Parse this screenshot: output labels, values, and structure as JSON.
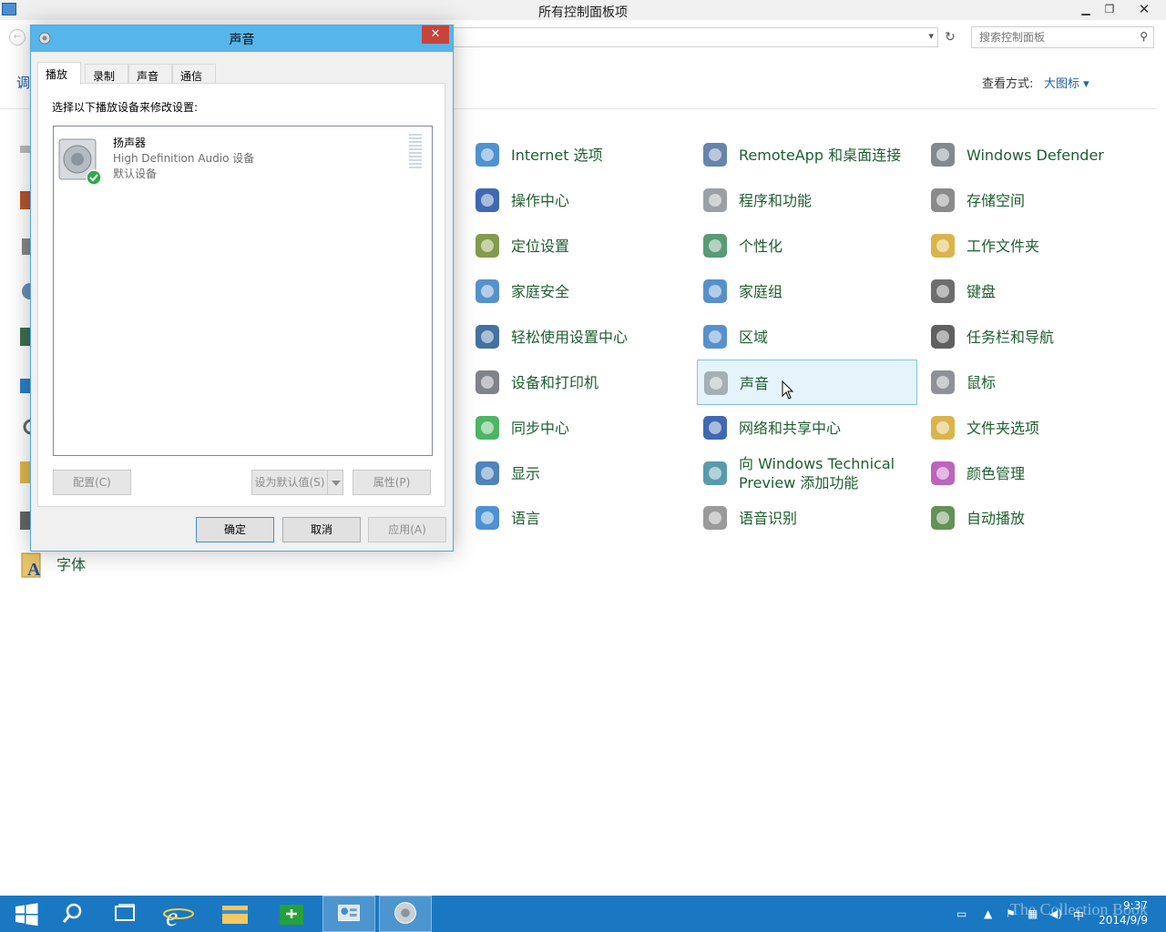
{
  "control_panel": {
    "title": "所有控制面板项",
    "search_placeholder": "搜索控制面板",
    "adjust_label": "调",
    "view_label": "查看方式:",
    "view_value": "大图标 ▾",
    "left_partial_item": "字体",
    "items": [
      {
        "label": "Internet 选项",
        "icon": "internet-options-icon"
      },
      {
        "label": "RemoteApp 和桌面连接",
        "icon": "remoteapp-icon"
      },
      {
        "label": "Windows Defender",
        "icon": "windows-defender-icon"
      },
      {
        "label": "操作中心",
        "icon": "action-center-flag-icon"
      },
      {
        "label": "程序和功能",
        "icon": "programs-features-icon"
      },
      {
        "label": "存储空间",
        "icon": "storage-spaces-icon"
      },
      {
        "label": "定位设置",
        "icon": "location-settings-icon"
      },
      {
        "label": "个性化",
        "icon": "personalization-icon"
      },
      {
        "label": "工作文件夹",
        "icon": "work-folders-icon"
      },
      {
        "label": "家庭安全",
        "icon": "family-safety-icon"
      },
      {
        "label": "家庭组",
        "icon": "homegroup-icon"
      },
      {
        "label": "键盘",
        "icon": "keyboard-icon"
      },
      {
        "label": "轻松使用设置中心",
        "icon": "ease-of-access-icon"
      },
      {
        "label": "区域",
        "icon": "region-icon"
      },
      {
        "label": "任务栏和导航",
        "icon": "taskbar-navigation-icon"
      },
      {
        "label": "设备和打印机",
        "icon": "devices-printers-icon"
      },
      {
        "label": "声音",
        "icon": "sound-icon"
      },
      {
        "label": "鼠标",
        "icon": "mouse-icon"
      },
      {
        "label": "同步中心",
        "icon": "sync-center-icon"
      },
      {
        "label": "网络和共享中心",
        "icon": "network-sharing-icon"
      },
      {
        "label": "文件夹选项",
        "icon": "folder-options-icon"
      },
      {
        "label": "显示",
        "icon": "display-icon"
      },
      {
        "label": "向 Windows Technical Preview 添加功能",
        "icon": "add-features-icon"
      },
      {
        "label": "颜色管理",
        "icon": "color-management-icon"
      },
      {
        "label": "语言",
        "icon": "language-icon"
      },
      {
        "label": "语音识别",
        "icon": "speech-recognition-icon"
      },
      {
        "label": "自动播放",
        "icon": "autoplay-icon"
      }
    ]
  },
  "sound_dialog": {
    "title": "声音",
    "tabs": [
      "播放",
      "录制",
      "声音",
      "通信"
    ],
    "active_tab": "播放",
    "instruction": "选择以下播放设备来修改设置:",
    "device": {
      "name": "扬声器",
      "description": "High Definition Audio 设备",
      "status": "默认设备"
    },
    "buttons": {
      "configure": "配置(C)",
      "set_default": "设为默认值(S)",
      "properties": "属性(P)",
      "ok": "确定",
      "cancel": "取消",
      "apply": "应用(A)"
    }
  },
  "taskbar": {
    "time": "9:37",
    "date": "2014/9/9",
    "ime": "中",
    "watermark": "The Collection Book"
  }
}
